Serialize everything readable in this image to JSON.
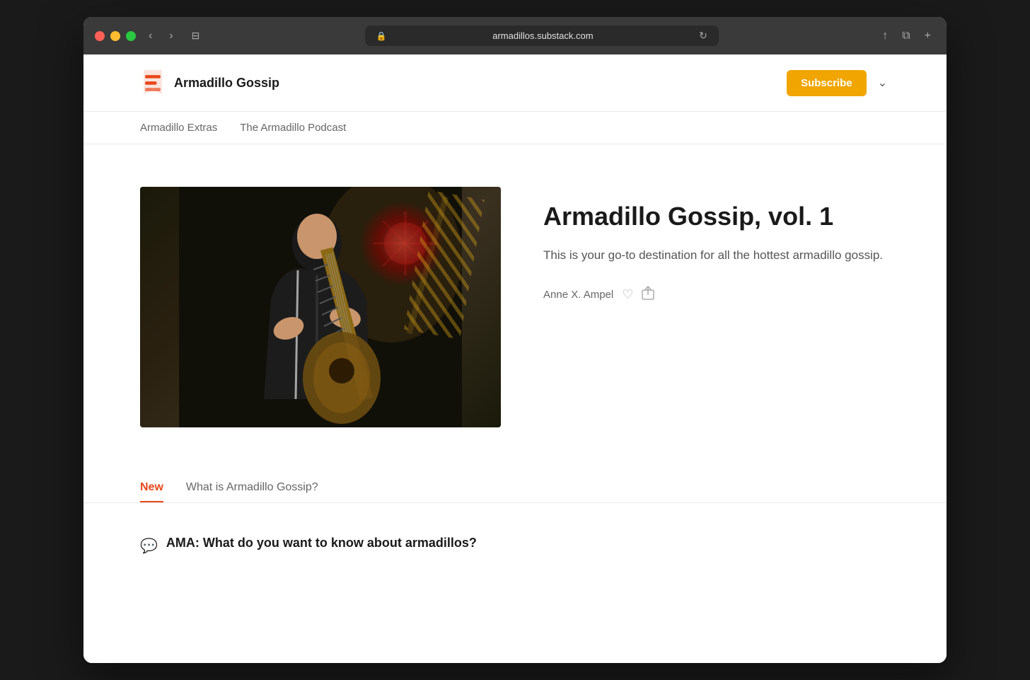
{
  "browser": {
    "url": "armadillos.substack.com",
    "back_btn": "‹",
    "forward_btn": "›",
    "sidebar_btn": "⊟",
    "refresh_btn": "↻",
    "share_btn": "↑",
    "tabs_btn": "⧉",
    "new_tab_btn": "+"
  },
  "header": {
    "brand_name": "Armadillo Gossip",
    "subscribe_label": "Subscribe"
  },
  "nav": {
    "items": [
      {
        "label": "Armadillo Extras"
      },
      {
        "label": "The Armadillo Podcast"
      }
    ]
  },
  "hero": {
    "title": "Armadillo Gossip, vol. 1",
    "description": "This is your go-to destination for all the hottest armadillo gossip.",
    "author": "Anne X. Ampel"
  },
  "tabs": {
    "items": [
      {
        "label": "New",
        "active": true
      },
      {
        "label": "What is Armadillo Gossip?",
        "active": false
      }
    ]
  },
  "posts": [
    {
      "icon": "💬",
      "title": "AMA: What do you want to know about armadillos?"
    }
  ]
}
